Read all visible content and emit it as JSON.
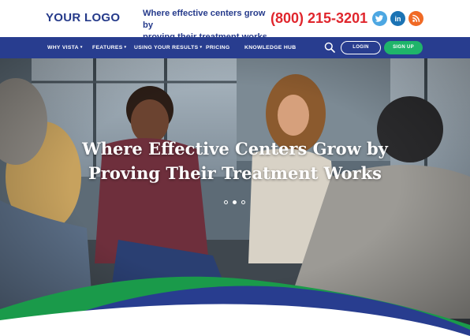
{
  "header": {
    "logo": "YOUR LOGO",
    "tagline_line1": "Where effective centers grow by",
    "tagline_line2": "proving their treatment works",
    "phone": "(800) 215-3201",
    "social": [
      {
        "icon": "twitter-icon",
        "color": "#4da7e2"
      },
      {
        "icon": "linkedin-icon",
        "color": "#1b73b4",
        "glyph": "in"
      },
      {
        "icon": "rss-icon",
        "color": "#f06a25"
      }
    ]
  },
  "nav": {
    "items": [
      {
        "label": "WHY VISTA",
        "dropdown": true
      },
      {
        "label": "FEATURES",
        "dropdown": true
      },
      {
        "label": "USING YOUR RESULTS",
        "dropdown": true
      },
      {
        "label": "PRICING",
        "dropdown": false
      },
      {
        "label": "KNOWLEDGE HUB",
        "dropdown": false
      }
    ],
    "login_label": "LOGIN",
    "signup_label": "SIGN UP",
    "caret": "▾"
  },
  "hero": {
    "headline_line1": "Where Effective Centers Grow by",
    "headline_line2": "Proving Their Treatment Works",
    "slides": 3,
    "active_slide": 2
  },
  "colors": {
    "brand_blue": "#283d8f",
    "phone_red": "#e0262d",
    "signup_green": "#1fb46a",
    "swoosh_green": "#1a9a4a"
  }
}
